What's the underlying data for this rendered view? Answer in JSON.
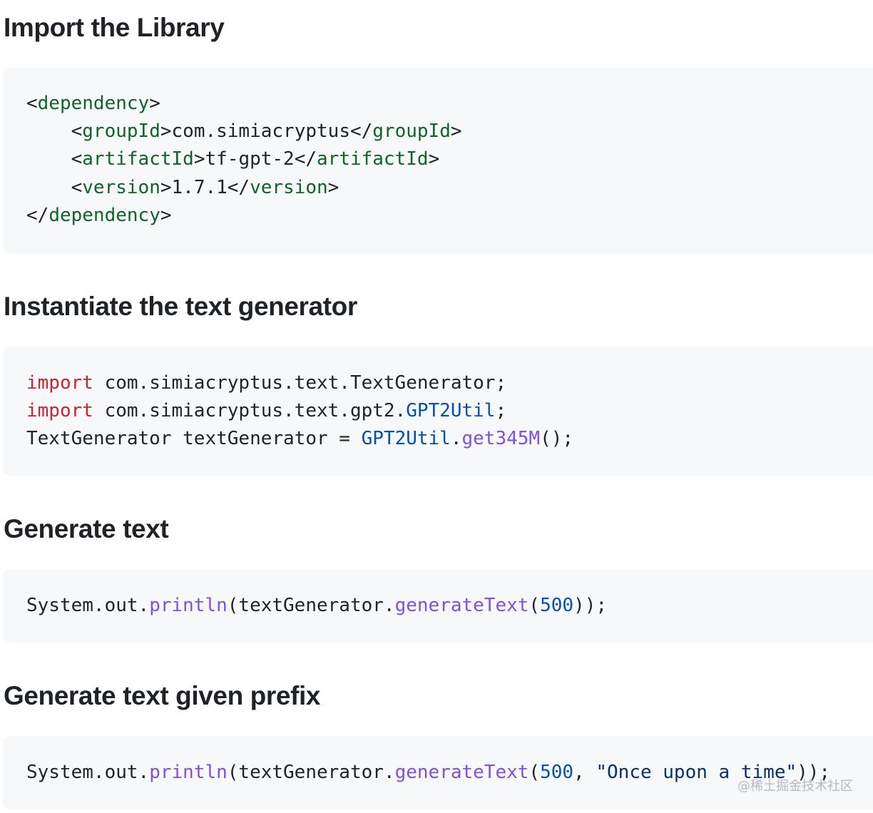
{
  "sections": [
    {
      "heading": "Import the Library",
      "code": {
        "line1": {
          "p1": "<",
          "t1": "dependency",
          "p2": ">"
        },
        "line2": {
          "indent": "    ",
          "p1": "<",
          "t1": "groupId",
          "p2": ">com.simiacryptus</",
          "t2": "groupId",
          "p3": ">"
        },
        "line3": {
          "indent": "    ",
          "p1": "<",
          "t1": "artifactId",
          "p2": ">tf-gpt-2</",
          "t2": "artifactId",
          "p3": ">"
        },
        "line4": {
          "indent": "    ",
          "p1": "<",
          "t1": "version",
          "p2": ">1.7.1</",
          "t2": "version",
          "p3": ">"
        },
        "line5": {
          "p1": "</",
          "t1": "dependency",
          "p2": ">"
        }
      }
    },
    {
      "heading": "Instantiate the text generator",
      "code": {
        "line1": {
          "kw": "import",
          "rest": " com.simiacryptus.text.TextGenerator;"
        },
        "line2": {
          "kw": "import",
          "pre": " com.simiacryptus.text.gpt2.",
          "cls": "GPT2Util",
          "post": ";"
        },
        "line3": {
          "pre": "TextGenerator textGenerator = ",
          "cls": "GPT2Util",
          "dot": ".",
          "fn": "get345M",
          "post": "();"
        }
      }
    },
    {
      "heading": "Generate text",
      "code": {
        "line1": {
          "pre": "System.out.",
          "fn1": "println",
          "mid1": "(textGenerator.",
          "fn2": "generateText",
          "paren": "(",
          "num": "500",
          "post": "));"
        }
      }
    },
    {
      "heading": "Generate text given prefix",
      "code": {
        "line1": {
          "pre": "System.out.",
          "fn1": "println",
          "mid1": "(textGenerator.",
          "fn2": "generateText",
          "paren": "(",
          "num": "500",
          "comma": ", ",
          "str": "\"Once upon a time\"",
          "post": "));"
        }
      }
    }
  ],
  "watermark": "@稀土掘金技术社区",
  "colors": {
    "heading": "#1f2328",
    "code_bg": "#f6f8fa",
    "code_text": "#1f2328",
    "xml_tag": "#116329",
    "keyword": "#cf222e",
    "class_name": "#0550ae",
    "method": "#8250df",
    "number": "#0550ae",
    "string": "#0a3069"
  }
}
